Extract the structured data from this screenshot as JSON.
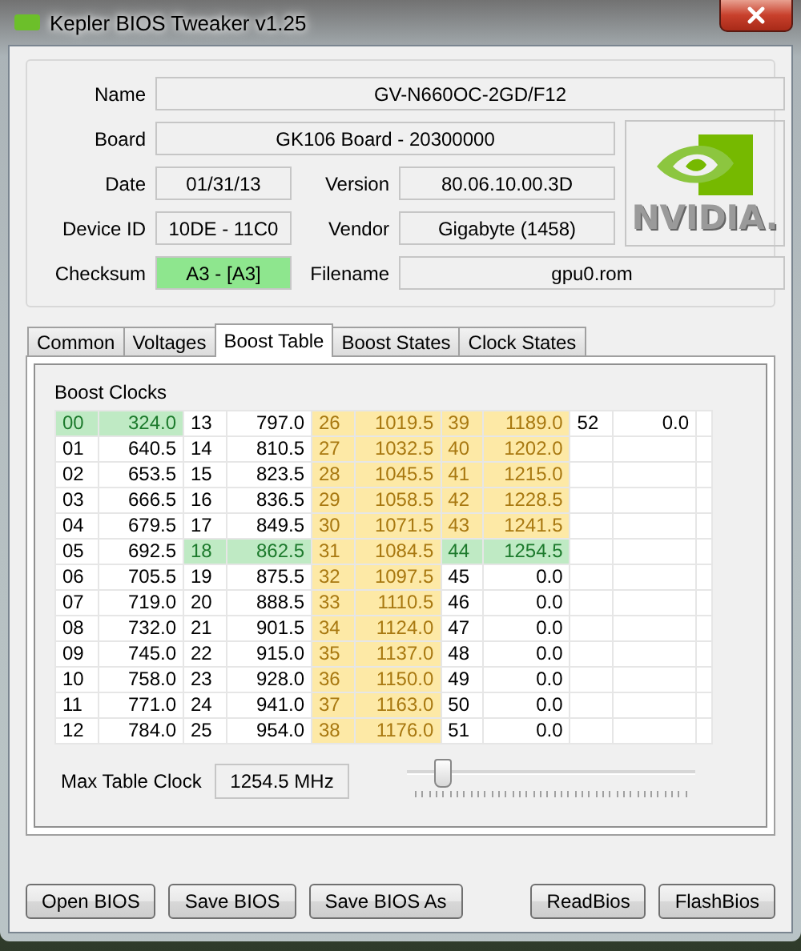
{
  "window": {
    "title": "Kepler BIOS Tweaker v1.25"
  },
  "info": {
    "name": {
      "label": "Name",
      "value": "GV-N660OC-2GD/F12"
    },
    "board": {
      "label": "Board",
      "value": "GK106 Board - 20300000"
    },
    "date": {
      "label": "Date",
      "value": "01/31/13"
    },
    "version": {
      "label": "Version",
      "value": "80.06.10.00.3D"
    },
    "device_id": {
      "label": "Device ID",
      "value": "10DE - 11C0"
    },
    "vendor": {
      "label": "Vendor",
      "value": "Gigabyte (1458)"
    },
    "checksum": {
      "label": "Checksum",
      "value": "A3 - [A3]",
      "ok": true
    },
    "filename": {
      "label": "Filename",
      "value": "gpu0.rom"
    },
    "logo_text": "NVIDIA."
  },
  "tabs": [
    {
      "label": "Common",
      "selected": false
    },
    {
      "label": "Voltages",
      "selected": false
    },
    {
      "label": "Boost Table",
      "selected": true
    },
    {
      "label": "Boost States",
      "selected": false
    },
    {
      "label": "Clock States",
      "selected": false
    }
  ],
  "boost_clocks": {
    "title": "Boost Clocks",
    "rows": [
      [
        {
          "index": "00",
          "clock": "324.0",
          "kind": "max"
        },
        {
          "index": "13",
          "clock": "797.0",
          "kind": "plain"
        },
        {
          "index": "26",
          "clock": "1019.5",
          "kind": "boost"
        },
        {
          "index": "39",
          "clock": "1189.0",
          "kind": "boost"
        },
        {
          "index": "52",
          "clock": "0.0",
          "kind": "plain"
        }
      ],
      [
        {
          "index": "01",
          "clock": "640.5",
          "kind": "plain"
        },
        {
          "index": "14",
          "clock": "810.5",
          "kind": "plain"
        },
        {
          "index": "27",
          "clock": "1032.5",
          "kind": "boost"
        },
        {
          "index": "40",
          "clock": "1202.0",
          "kind": "boost"
        }
      ],
      [
        {
          "index": "02",
          "clock": "653.5",
          "kind": "plain"
        },
        {
          "index": "15",
          "clock": "823.5",
          "kind": "plain"
        },
        {
          "index": "28",
          "clock": "1045.5",
          "kind": "boost"
        },
        {
          "index": "41",
          "clock": "1215.0",
          "kind": "boost"
        }
      ],
      [
        {
          "index": "03",
          "clock": "666.5",
          "kind": "plain"
        },
        {
          "index": "16",
          "clock": "836.5",
          "kind": "plain"
        },
        {
          "index": "29",
          "clock": "1058.5",
          "kind": "boost"
        },
        {
          "index": "42",
          "clock": "1228.5",
          "kind": "boost"
        }
      ],
      [
        {
          "index": "04",
          "clock": "679.5",
          "kind": "plain"
        },
        {
          "index": "17",
          "clock": "849.5",
          "kind": "plain"
        },
        {
          "index": "30",
          "clock": "1071.5",
          "kind": "boost"
        },
        {
          "index": "43",
          "clock": "1241.5",
          "kind": "boost"
        }
      ],
      [
        {
          "index": "05",
          "clock": "692.5",
          "kind": "plain"
        },
        {
          "index": "18",
          "clock": "862.5",
          "kind": "max"
        },
        {
          "index": "31",
          "clock": "1084.5",
          "kind": "boost"
        },
        {
          "index": "44",
          "clock": "1254.5",
          "kind": "max"
        }
      ],
      [
        {
          "index": "06",
          "clock": "705.5",
          "kind": "plain"
        },
        {
          "index": "19",
          "clock": "875.5",
          "kind": "plain"
        },
        {
          "index": "32",
          "clock": "1097.5",
          "kind": "boost"
        },
        {
          "index": "45",
          "clock": "0.0",
          "kind": "plain"
        }
      ],
      [
        {
          "index": "07",
          "clock": "719.0",
          "kind": "plain"
        },
        {
          "index": "20",
          "clock": "888.5",
          "kind": "plain"
        },
        {
          "index": "33",
          "clock": "1110.5",
          "kind": "boost"
        },
        {
          "index": "46",
          "clock": "0.0",
          "kind": "plain"
        }
      ],
      [
        {
          "index": "08",
          "clock": "732.0",
          "kind": "plain"
        },
        {
          "index": "21",
          "clock": "901.5",
          "kind": "plain"
        },
        {
          "index": "34",
          "clock": "1124.0",
          "kind": "boost"
        },
        {
          "index": "47",
          "clock": "0.0",
          "kind": "plain"
        }
      ],
      [
        {
          "index": "09",
          "clock": "745.0",
          "kind": "plain"
        },
        {
          "index": "22",
          "clock": "915.0",
          "kind": "plain"
        },
        {
          "index": "35",
          "clock": "1137.0",
          "kind": "boost"
        },
        {
          "index": "48",
          "clock": "0.0",
          "kind": "plain"
        }
      ],
      [
        {
          "index": "10",
          "clock": "758.0",
          "kind": "plain"
        },
        {
          "index": "23",
          "clock": "928.0",
          "kind": "plain"
        },
        {
          "index": "36",
          "clock": "1150.0",
          "kind": "boost"
        },
        {
          "index": "49",
          "clock": "0.0",
          "kind": "plain"
        }
      ],
      [
        {
          "index": "11",
          "clock": "771.0",
          "kind": "plain"
        },
        {
          "index": "24",
          "clock": "941.0",
          "kind": "plain"
        },
        {
          "index": "37",
          "clock": "1163.0",
          "kind": "boost"
        },
        {
          "index": "50",
          "clock": "0.0",
          "kind": "plain"
        }
      ],
      [
        {
          "index": "12",
          "clock": "784.0",
          "kind": "plain"
        },
        {
          "index": "25",
          "clock": "954.0",
          "kind": "plain"
        },
        {
          "index": "38",
          "clock": "1176.0",
          "kind": "boost"
        },
        {
          "index": "51",
          "clock": "0.0",
          "kind": "plain"
        }
      ]
    ],
    "max_label": "Max Table Clock",
    "max_value": "1254.5 MHz",
    "slider": {
      "level": 0.1
    }
  },
  "buttons_left": [
    "Open BIOS",
    "Save BIOS",
    "Save BIOS As"
  ],
  "buttons_right": [
    "ReadBios",
    "FlashBios"
  ]
}
